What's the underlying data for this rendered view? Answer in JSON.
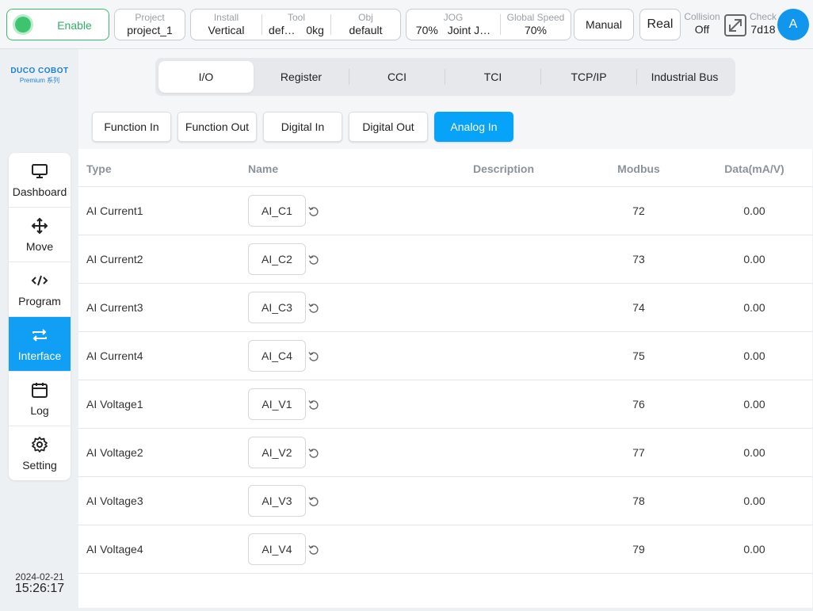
{
  "topbar": {
    "enable_label": "Enable",
    "project": {
      "label": "Project",
      "value": "project_1"
    },
    "install": {
      "label": "Install",
      "value": "Vertical"
    },
    "tool": {
      "label": "Tool",
      "name": "def…",
      "weight": "0kg"
    },
    "obj": {
      "label": "Obj",
      "value": "default"
    },
    "jog": {
      "label": "JOG",
      "percent": "70%",
      "mode": "Joint J…"
    },
    "global_speed": {
      "label": "Global Speed",
      "value": "70%"
    },
    "manual_label": "Manual",
    "real_label": "Real",
    "collision": {
      "label": "Collision",
      "value": "Off"
    },
    "check": {
      "label": "Check",
      "value": "7d18"
    },
    "avatar_letter": "A",
    "colors": {
      "enable_green": "#3ec471",
      "accent_blue": "#06a3f8"
    }
  },
  "logo": {
    "brand": "DUCO COBOT",
    "series": "Premium 系列"
  },
  "sidebar": {
    "items": [
      {
        "label": "Dashboard",
        "icon": "monitor-icon"
      },
      {
        "label": "Move",
        "icon": "move-arrows-icon"
      },
      {
        "label": "Program",
        "icon": "code-icon"
      },
      {
        "label": "Interface",
        "icon": "swap-arrows-icon"
      },
      {
        "label": "Log",
        "icon": "calendar-icon"
      },
      {
        "label": "Setting",
        "icon": "gear-icon"
      }
    ],
    "active": "Interface"
  },
  "datetime": {
    "date": "2024-02-21",
    "time": "15:26:17"
  },
  "tabs": [
    "I/O",
    "Register",
    "CCI",
    "TCI",
    "TCP/IP",
    "Industrial Bus"
  ],
  "active_tab": "I/O",
  "subtabs": [
    "Function In",
    "Function Out",
    "Digital In",
    "Digital Out",
    "Analog In"
  ],
  "active_subtab": "Analog In",
  "table": {
    "headers": {
      "type": "Type",
      "name": "Name",
      "description": "Description",
      "modbus": "Modbus",
      "data": "Data(mA/V)"
    },
    "rows": [
      {
        "type": "AI Current1",
        "name": "AI_C1",
        "modbus": "72",
        "data": "0.00"
      },
      {
        "type": "AI Current2",
        "name": "AI_C2",
        "modbus": "73",
        "data": "0.00"
      },
      {
        "type": "AI Current3",
        "name": "AI_C3",
        "modbus": "74",
        "data": "0.00"
      },
      {
        "type": "AI Current4",
        "name": "AI_C4",
        "modbus": "75",
        "data": "0.00"
      },
      {
        "type": "AI Voltage1",
        "name": "AI_V1",
        "modbus": "76",
        "data": "0.00"
      },
      {
        "type": "AI Voltage2",
        "name": "AI_V2",
        "modbus": "77",
        "data": "0.00"
      },
      {
        "type": "AI Voltage3",
        "name": "AI_V3",
        "modbus": "78",
        "data": "0.00"
      },
      {
        "type": "AI Voltage4",
        "name": "AI_V4",
        "modbus": "79",
        "data": "0.00"
      }
    ]
  }
}
